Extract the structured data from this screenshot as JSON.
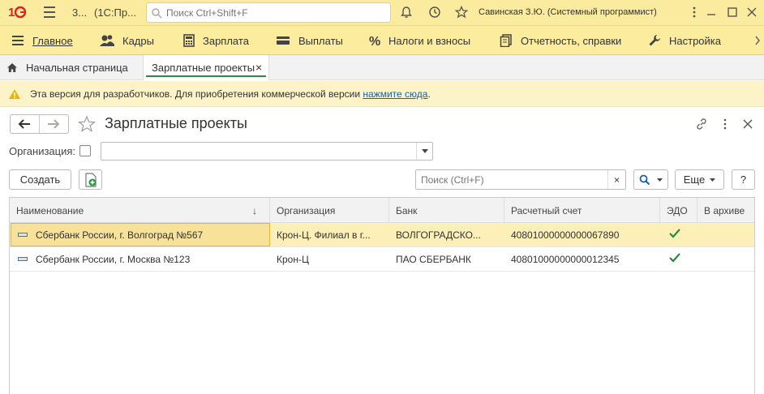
{
  "titlebar": {
    "num": "3...",
    "app": "(1С:Пр...",
    "search_placeholder": "Поиск Ctrl+Shift+F",
    "user": "Савинская З.Ю. (Системный программист)"
  },
  "sections": [
    {
      "label": "Главное",
      "icon": "menu-icon"
    },
    {
      "label": "Кадры",
      "icon": "people-icon"
    },
    {
      "label": "Зарплата",
      "icon": "calculator-icon"
    },
    {
      "label": "Выплаты",
      "icon": "wallet-icon"
    },
    {
      "label": "Налоги и взносы",
      "icon": "percent-icon"
    },
    {
      "label": "Отчетность, справки",
      "icon": "documents-icon"
    },
    {
      "label": "Настройка",
      "icon": "wrench-icon"
    }
  ],
  "tabs": {
    "home": "Начальная страница",
    "active": "Зарплатные проекты",
    "close": "×"
  },
  "banner": {
    "text": "Эта версия для разработчиков. Для приобретения коммерческой версии ",
    "link": "нажмите сюда",
    "suffix": "."
  },
  "form": {
    "title": "Зарплатные проекты",
    "org_label": "Организация:",
    "org_value": ""
  },
  "toolbar": {
    "create": "Создать",
    "search_placeholder": "Поиск (Ctrl+F)",
    "clear": "×",
    "more": "Еще",
    "help": "?"
  },
  "table": {
    "columns": [
      "Наименование",
      "Организация",
      "Банк",
      "Расчетный счет",
      "ЭДО",
      "В архиве"
    ],
    "sort_indicator": "↓",
    "rows": [
      {
        "name": "Сбербанк России, г. Волгоград №567",
        "org": "Крон-Ц. Филиал в г...",
        "bank": "ВОЛГОГРАДСКО...",
        "account": "40801000000000067890",
        "edo": true,
        "archive": ""
      },
      {
        "name": "Сбербанк России, г. Москва №123",
        "org": "Крон-Ц",
        "bank": "ПАО СБЕРБАНК",
        "account": "40801000000000012345",
        "edo": true,
        "archive": ""
      }
    ]
  },
  "colors": {
    "accent_yellow": "#fbec9e",
    "selection": "#fcefb7",
    "check_green": "#2a8a3e",
    "link": "#1a5fa8"
  }
}
